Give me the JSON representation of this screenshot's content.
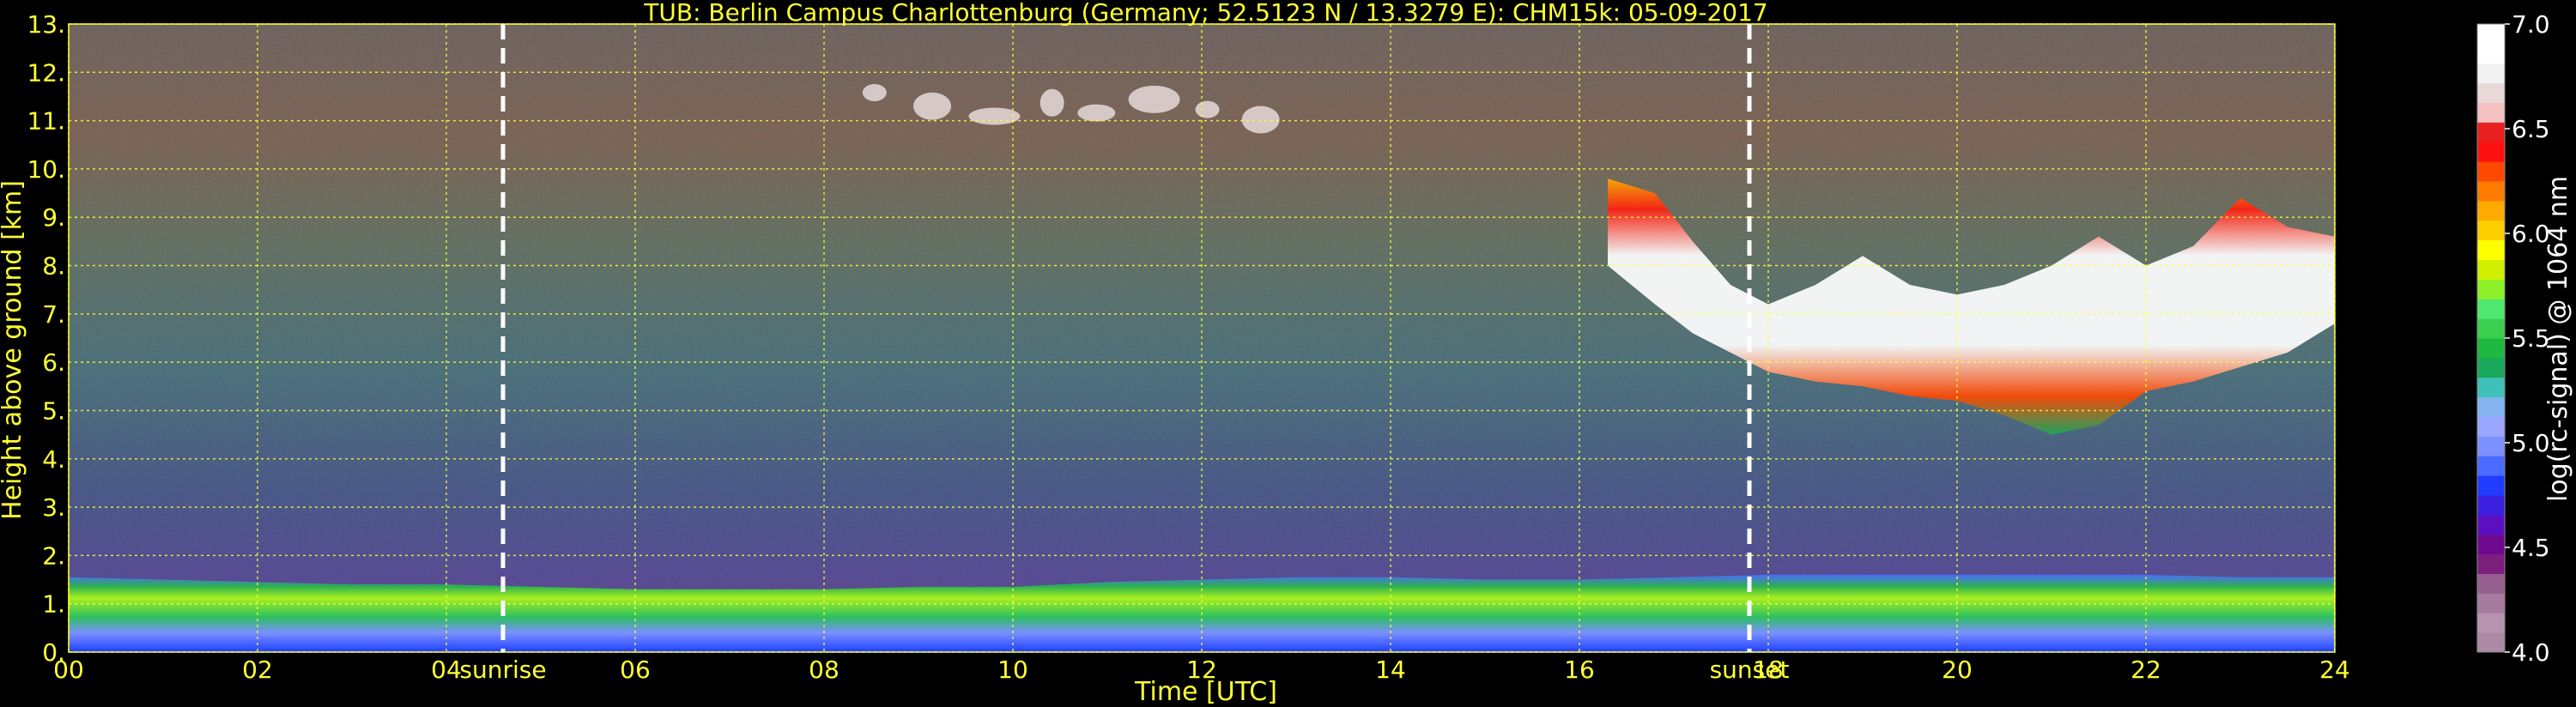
{
  "chart_data": {
    "type": "heatmap",
    "title": "TUB: Berlin Campus Charlottenburg (Germany; 52.5123 N / 13.3279 E):    CHM15k: 05-09-2017",
    "xlabel": "Time [UTC]",
    "ylabel": "Height above ground [km]",
    "xlim": [
      0,
      24
    ],
    "ylim": [
      0,
      13
    ],
    "x_ticks": [
      "00",
      "02",
      "04",
      "06",
      "08",
      "10",
      "12",
      "14",
      "16",
      "18",
      "20",
      "22",
      "24"
    ],
    "y_ticks": [
      "0.",
      "1.",
      "2.",
      "3.",
      "4.",
      "5.",
      "6.",
      "7.",
      "8.",
      "9.",
      "10.",
      "11.",
      "12.",
      "13."
    ],
    "grid": true,
    "colorbar": {
      "label": "log(rc-signal) @ 1064 nm",
      "range": [
        4.0,
        7.0
      ],
      "ticks": [
        "4.0",
        "4.5",
        "5.0",
        "5.5",
        "6.0",
        "6.5",
        "7.0"
      ],
      "colors": [
        "#ac8aa6",
        "#b893b0",
        "#a77aa0",
        "#955f8f",
        "#7d1f7d",
        "#6e0a8f",
        "#5a10c0",
        "#3c20e0",
        "#1f3cff",
        "#4a6bff",
        "#7c90ff",
        "#9aa6ff",
        "#86b4f0",
        "#3fc0b8",
        "#1aa85a",
        "#1fb840",
        "#3cd050",
        "#50e870",
        "#8ef028",
        "#d0f000",
        "#ffff00",
        "#ffd000",
        "#ffaa00",
        "#ff7a00",
        "#ff4800",
        "#ff1010",
        "#e82020",
        "#f4c0c0",
        "#e8d8d8",
        "#f2f2f2",
        "#ffffff",
        "#ffffff"
      ]
    },
    "annotations": [
      {
        "text": "sunrise",
        "x": 4.6
      },
      {
        "text": "sunset",
        "x": 17.8
      }
    ],
    "layers": [
      {
        "name": "boundary layer",
        "x": [
          0,
          24
        ],
        "y": [
          0.0,
          1.6
        ],
        "colors": "blue-green-yellow"
      },
      {
        "name": "cirrus cloud",
        "x": [
          16.3,
          24
        ],
        "y": [
          4.3,
          10.0
        ],
        "colors": "white-red"
      },
      {
        "name": "upper cloud fragments",
        "x": [
          8.3,
          13.0
        ],
        "y": [
          10.6,
          12.0
        ],
        "colors": "white"
      }
    ],
    "boundary_layer_top_km": [
      [
        0,
        1.55
      ],
      [
        1,
        1.5
      ],
      [
        2,
        1.45
      ],
      [
        3,
        1.4
      ],
      [
        4,
        1.4
      ],
      [
        5,
        1.35
      ],
      [
        6,
        1.3
      ],
      [
        7,
        1.3
      ],
      [
        8,
        1.3
      ],
      [
        9,
        1.35
      ],
      [
        10,
        1.35
      ],
      [
        11,
        1.45
      ],
      [
        12,
        1.5
      ],
      [
        13,
        1.55
      ],
      [
        14,
        1.55
      ],
      [
        15,
        1.5
      ],
      [
        16,
        1.5
      ],
      [
        17,
        1.55
      ],
      [
        18,
        1.6
      ],
      [
        19,
        1.6
      ],
      [
        20,
        1.6
      ],
      [
        21,
        1.6
      ],
      [
        22,
        1.6
      ],
      [
        23,
        1.55
      ],
      [
        24,
        1.55
      ]
    ],
    "cirrus_base_km": [
      [
        16.3,
        8.0
      ],
      [
        16.8,
        7.2
      ],
      [
        17.2,
        6.6
      ],
      [
        17.6,
        6.2
      ],
      [
        18.0,
        5.8
      ],
      [
        18.5,
        5.6
      ],
      [
        19.0,
        5.5
      ],
      [
        19.5,
        5.3
      ],
      [
        20.0,
        5.2
      ],
      [
        20.5,
        4.9
      ],
      [
        21.0,
        4.5
      ],
      [
        21.5,
        4.7
      ],
      [
        22.0,
        5.4
      ],
      [
        22.5,
        5.6
      ],
      [
        23.0,
        5.9
      ],
      [
        23.5,
        6.2
      ],
      [
        24.0,
        6.8
      ]
    ],
    "cirrus_top_km": [
      [
        16.3,
        9.8
      ],
      [
        16.8,
        9.5
      ],
      [
        17.2,
        8.5
      ],
      [
        17.6,
        7.6
      ],
      [
        18.0,
        7.2
      ],
      [
        18.5,
        7.6
      ],
      [
        19.0,
        8.2
      ],
      [
        19.5,
        7.6
      ],
      [
        20.0,
        7.4
      ],
      [
        20.5,
        7.6
      ],
      [
        21.0,
        8.0
      ],
      [
        21.5,
        8.6
      ],
      [
        22.0,
        8.0
      ],
      [
        22.5,
        8.4
      ],
      [
        23.0,
        9.4
      ],
      [
        23.5,
        8.8
      ],
      [
        24.0,
        8.6
      ]
    ]
  }
}
